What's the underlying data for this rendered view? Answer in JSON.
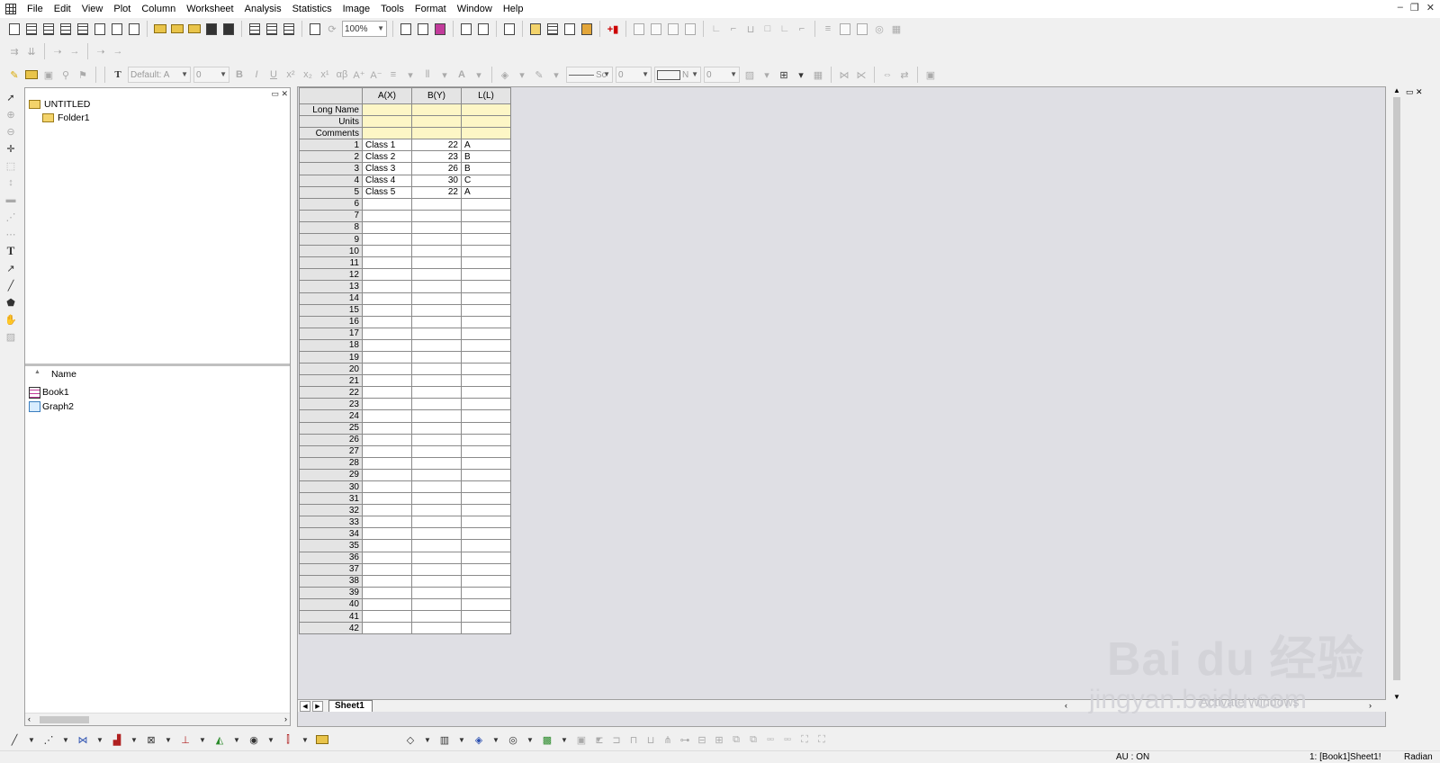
{
  "menubar": {
    "items": [
      "File",
      "Edit",
      "View",
      "Plot",
      "Column",
      "Worksheet",
      "Analysis",
      "Statistics",
      "Image",
      "Tools",
      "Format",
      "Window",
      "Help"
    ]
  },
  "toolbar": {
    "zoom": "100%",
    "font_combo": "Default: A",
    "font_size": "0",
    "line_style": "Sc",
    "line_width": "0",
    "fill_combo": "N",
    "fill_size": "0",
    "bold": "B",
    "italic": "I",
    "underline": "U"
  },
  "explorer": {
    "tree": {
      "root": "UNTITLED",
      "child": "Folder1"
    },
    "list_header": "Name",
    "list": [
      "Book1",
      "Graph2"
    ]
  },
  "worksheet": {
    "columns": [
      "A(X)",
      "B(Y)",
      "L(L)"
    ],
    "meta_rows": [
      "Long Name",
      "Units",
      "Comments"
    ],
    "rows": [
      {
        "n": "1",
        "a": "Class 1",
        "b": "22",
        "l": "A"
      },
      {
        "n": "2",
        "a": "Class 2",
        "b": "23",
        "l": "B"
      },
      {
        "n": "3",
        "a": "Class 3",
        "b": "26",
        "l": "B"
      },
      {
        "n": "4",
        "a": "Class 4",
        "b": "30",
        "l": "C"
      },
      {
        "n": "5",
        "a": "Class 5",
        "b": "22",
        "l": "A"
      }
    ],
    "total_rows": 42,
    "sheet_tab": "Sheet1"
  },
  "status": {
    "au": "AU : ON",
    "active": "1: [Book1]Sheet1!",
    "angle": "Radian"
  },
  "watermark": {
    "brand": "Bai du 经验",
    "url": "jingyan.baidu.com",
    "activate": "Activate Windows"
  }
}
